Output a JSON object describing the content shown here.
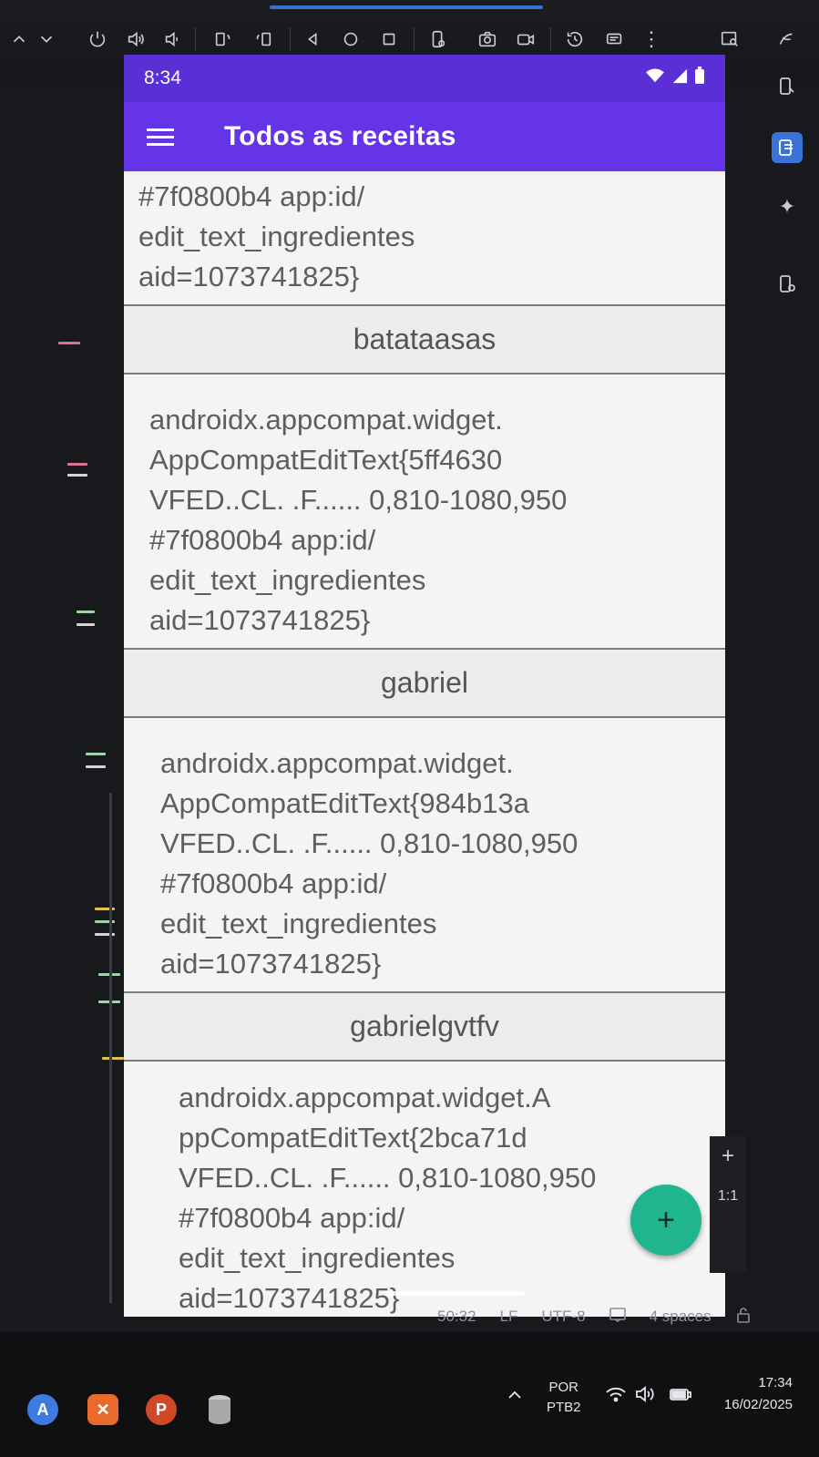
{
  "device_status": {
    "time": "8:34"
  },
  "app": {
    "title": "Todos as receitas",
    "fab_label": "+"
  },
  "list": {
    "first_partial_desc": [
      "#7f0800b4 app:id/",
      "edit_text_ingredientes",
      "aid=1073741825}"
    ],
    "items": [
      {
        "name": "batataasas",
        "desc_lines": [
          "androidx.appcompat.widget.",
          "AppCompatEditText{5ff4630",
          "VFED..CL. .F...... 0,810-1080,950",
          "#7f0800b4 app:id/",
          "edit_text_ingredientes",
          "aid=1073741825}"
        ]
      },
      {
        "name": "gabriel",
        "desc_lines": [
          "androidx.appcompat.widget.",
          "AppCompatEditText{984b13a",
          "VFED..CL. .F...... 0,810-1080,950",
          "#7f0800b4 app:id/",
          "edit_text_ingredientes",
          "aid=1073741825}"
        ]
      },
      {
        "name": "gabrielgvtfv",
        "desc_lines": [
          "androidx.appcompat.widget.A",
          "ppCompatEditText{2bca71d",
          "VFED..CL. .F...... 0,810-1080,950",
          "#7f0800b4 app:id/",
          "edit_text_ingredientes",
          "aid=1073741825}"
        ]
      }
    ]
  },
  "zoom_controls": {
    "zoom_in": "+",
    "ratio": "1:1"
  },
  "ide_status": {
    "position": "50:32",
    "line_ending": "LF",
    "encoding": "UTF-8",
    "indent": "4 spaces"
  },
  "taskbar": {
    "language_line1": "POR",
    "language_line2": "PTB2",
    "clock_time": "17:34",
    "clock_date": "16/02/2025"
  },
  "colors": {
    "status_bar": "#5a2fd6",
    "app_bar": "#6534e8",
    "fab": "#1fb58f"
  }
}
